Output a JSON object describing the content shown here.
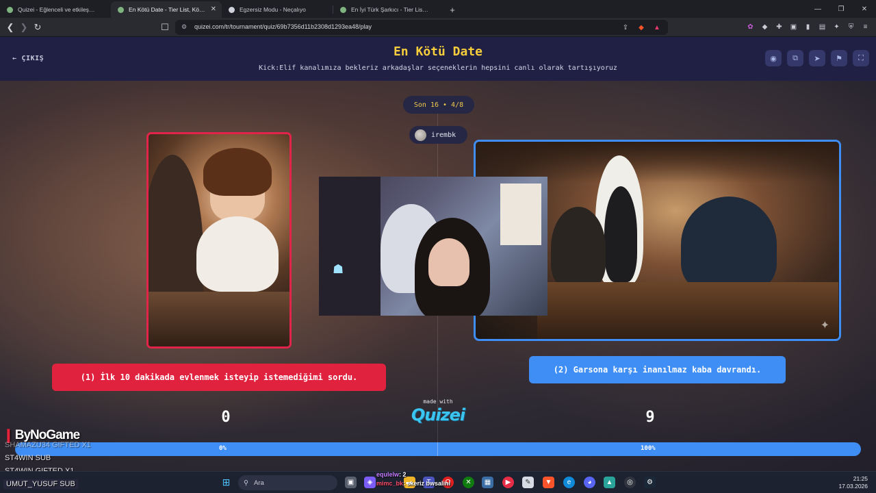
{
  "browser": {
    "tabs": [
      {
        "label": "Quizei - Eğlenceli ve etkileşimli quiz",
        "active": false
      },
      {
        "label": "En Kötü Date - Tier List, Kör Sıral",
        "active": true
      },
      {
        "label": "Egzersiz Modu - Neçalıyo",
        "active": false
      },
      {
        "label": "En İyi Türk Şarkıcı - Tier List | Blind Ra",
        "active": false
      }
    ],
    "new_tab": "+",
    "url": "quizei.com/tr/tournament/quiz/69b7356d11b2308d1293ea48/play"
  },
  "header": {
    "exit_label": "ÇIKIŞ",
    "title": "En Kötü Date",
    "subtitle": "Kick:Elif kanalımıza bekleriz arkadaşlar seçeneklerin hepsini canlı olarak tartışıyoruz",
    "buttons": [
      "eye-icon",
      "copy-icon",
      "share-icon",
      "flag-icon",
      "fullscreen-icon"
    ]
  },
  "round": {
    "label": "Son 16 • 4/8"
  },
  "user": {
    "name": "irembk"
  },
  "options": {
    "left": {
      "text": "(1) İlk 10 dakikada evlenmek isteyip istemediğimi sordu.",
      "votes": "0",
      "percent_label": "0%",
      "fraction": 0.0,
      "color": "#e0223f"
    },
    "right": {
      "text": "(2) Garsona karşı inanılmaz kaba davrandı.",
      "votes": "9",
      "percent_label": "100%",
      "fraction": 1.0,
      "color": "#3f8ef5"
    }
  },
  "branding": {
    "made_with": "made with",
    "logo": "Quizei"
  },
  "overlay": {
    "sponsor": "ByNoGame",
    "lines": [
      {
        "text": "SHAMAZU34  GIFTED X1",
        "dim": true
      },
      {
        "text": "ST4WIN  SUB",
        "dim": false
      },
      {
        "text": "ST4WIN  GIFTED X1",
        "dim": false
      },
      {
        "text": "UMUT_YUSUF  SUB",
        "dim": false
      }
    ],
    "chat": [
      {
        "user": "equlelw",
        "msg": ": 2",
        "color": "#c77dff"
      },
      {
        "user": "mimc_bk",
        "msg": ": skeriz bwsalini",
        "color": "#ff4d6d"
      }
    ]
  },
  "taskbar": {
    "search_placeholder": "Ara",
    "time": "21:25",
    "date": "17.03.2026"
  }
}
